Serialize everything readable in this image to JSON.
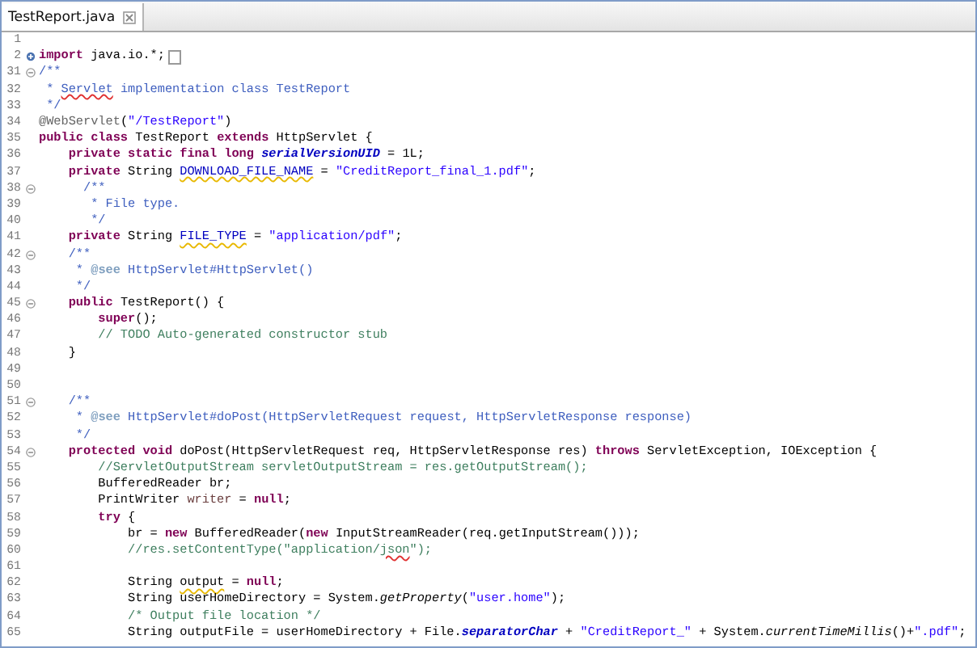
{
  "tabs": [
    {
      "label": "TestReport.java",
      "selected": true
    }
  ],
  "editor": {
    "lines": [
      {
        "number": "1"
      },
      {
        "number": "2",
        "collapsed": true,
        "folded_marker": true,
        "tokens": [
          {
            "kind": "kw",
            "text": "import"
          },
          {
            "kind": "plain",
            "text": " java.io.*;"
          }
        ]
      },
      {
        "number": "31",
        "collapsed": false,
        "tokens": [
          {
            "kind": "doc",
            "text": "/**"
          }
        ]
      },
      {
        "number": "32",
        "tokens": [
          {
            "kind": "doc",
            "text": " * "
          },
          {
            "kind": "doc-misspelled",
            "text": "Servlet"
          },
          {
            "kind": "doc",
            "text": " implementation class TestReport"
          }
        ]
      },
      {
        "number": "33",
        "tokens": [
          {
            "kind": "doc",
            "text": " */"
          }
        ]
      },
      {
        "number": "34",
        "tokens": [
          {
            "kind": "annot",
            "text": "@WebServlet"
          },
          {
            "kind": "plain",
            "text": "("
          },
          {
            "kind": "str",
            "text": "\"/TestReport\""
          },
          {
            "kind": "plain",
            "text": ")"
          }
        ]
      },
      {
        "number": "35",
        "tokens": [
          {
            "kind": "kw",
            "text": "public class"
          },
          {
            "kind": "plain",
            "text": " TestReport "
          },
          {
            "kind": "kw",
            "text": "extends"
          },
          {
            "kind": "plain",
            "text": " HttpServlet {"
          }
        ]
      },
      {
        "number": "36",
        "tokens": [
          {
            "kind": "kw",
            "text": "    private static final long "
          },
          {
            "kind": "static-field",
            "text": "serialVersionUID"
          },
          {
            "kind": "plain",
            "text": " = 1L;"
          }
        ]
      },
      {
        "number": "37",
        "tokens": [
          {
            "kind": "kw",
            "text": "    private"
          },
          {
            "kind": "plain",
            "text": " String "
          },
          {
            "kind": "field-warning",
            "text": "DOWNLOAD_FILE_NAME"
          },
          {
            "kind": "plain",
            "text": " = "
          },
          {
            "kind": "str",
            "text": "\"CreditReport_final_1.pdf\""
          },
          {
            "kind": "plain",
            "text": ";"
          }
        ]
      },
      {
        "number": "38",
        "collapsed": false,
        "tokens": [
          {
            "kind": "doc",
            "text": "      /**"
          }
        ]
      },
      {
        "number": "39",
        "tokens": [
          {
            "kind": "doc",
            "text": "       * File type."
          }
        ]
      },
      {
        "number": "40",
        "tokens": [
          {
            "kind": "doc",
            "text": "       */"
          }
        ]
      },
      {
        "number": "41",
        "tokens": [
          {
            "kind": "kw",
            "text": "    private"
          },
          {
            "kind": "plain",
            "text": " String "
          },
          {
            "kind": "field-warning",
            "text": "FILE_TYPE"
          },
          {
            "kind": "plain",
            "text": " = "
          },
          {
            "kind": "str",
            "text": "\"application/pdf\""
          },
          {
            "kind": "plain",
            "text": ";"
          }
        ]
      },
      {
        "number": "42",
        "collapsed": false,
        "tokens": [
          {
            "kind": "doc",
            "text": "    /**"
          }
        ]
      },
      {
        "number": "43",
        "tokens": [
          {
            "kind": "doc",
            "text": "     * "
          },
          {
            "kind": "doctag",
            "text": "@see"
          },
          {
            "kind": "doc",
            "text": " HttpServlet#HttpServlet()"
          }
        ]
      },
      {
        "number": "44",
        "tokens": [
          {
            "kind": "doc",
            "text": "     */"
          }
        ]
      },
      {
        "number": "45",
        "collapsed": false,
        "tokens": [
          {
            "kind": "kw",
            "text": "    public"
          },
          {
            "kind": "plain",
            "text": " TestReport() {"
          }
        ]
      },
      {
        "number": "46",
        "tokens": [
          {
            "kind": "kw",
            "text": "        super"
          },
          {
            "kind": "plain",
            "text": "();"
          }
        ]
      },
      {
        "number": "47",
        "tokens": [
          {
            "kind": "comment",
            "text": "        // TODO Auto-generated constructor stub"
          }
        ]
      },
      {
        "number": "48",
        "tokens": [
          {
            "kind": "plain",
            "text": "    }"
          }
        ]
      },
      {
        "number": "49"
      },
      {
        "number": "50"
      },
      {
        "number": "51",
        "collapsed": false,
        "tokens": [
          {
            "kind": "doc",
            "text": "    /**"
          }
        ]
      },
      {
        "number": "52",
        "tokens": [
          {
            "kind": "doc",
            "text": "     * "
          },
          {
            "kind": "doctag",
            "text": "@see"
          },
          {
            "kind": "doc",
            "text": " HttpServlet#doPost(HttpServletRequest request, HttpServletResponse response)"
          }
        ]
      },
      {
        "number": "53",
        "tokens": [
          {
            "kind": "doc",
            "text": "     */"
          }
        ]
      },
      {
        "number": "54",
        "collapsed": false,
        "tokens": [
          {
            "kind": "kw",
            "text": "    protected void"
          },
          {
            "kind": "plain",
            "text": " doPost(HttpServletRequest req, HttpServletResponse res) "
          },
          {
            "kind": "kw",
            "text": "throws"
          },
          {
            "kind": "plain",
            "text": " ServletException, IOException {"
          }
        ]
      },
      {
        "number": "55",
        "tokens": [
          {
            "kind": "comment",
            "text": "        //ServletOutputStream servletOutputStream = res.getOutputStream();"
          }
        ]
      },
      {
        "number": "56",
        "tokens": [
          {
            "kind": "plain",
            "text": "        BufferedReader br;"
          }
        ]
      },
      {
        "number": "57",
        "tokens": [
          {
            "kind": "plain",
            "text": "        PrintWriter "
          },
          {
            "kind": "local",
            "text": "writer"
          },
          {
            "kind": "plain",
            "text": " = "
          },
          {
            "kind": "kw",
            "text": "null"
          },
          {
            "kind": "plain",
            "text": ";"
          }
        ]
      },
      {
        "number": "58",
        "tokens": [
          {
            "kind": "kw",
            "text": "        try"
          },
          {
            "kind": "plain",
            "text": " {"
          }
        ]
      },
      {
        "number": "59",
        "tokens": [
          {
            "kind": "plain",
            "text": "            br = "
          },
          {
            "kind": "kw",
            "text": "new"
          },
          {
            "kind": "plain",
            "text": " BufferedReader("
          },
          {
            "kind": "kw",
            "text": "new"
          },
          {
            "kind": "plain",
            "text": " InputStreamReader(req.getInputStream()));"
          }
        ]
      },
      {
        "number": "60",
        "tokens": [
          {
            "kind": "comment",
            "text": "            //res.setContentType(\"application/"
          },
          {
            "kind": "comment-misspelled",
            "text": "json"
          },
          {
            "kind": "comment",
            "text": "\");"
          }
        ]
      },
      {
        "number": "61"
      },
      {
        "number": "62",
        "tokens": [
          {
            "kind": "plain",
            "text": "            String "
          },
          {
            "kind": "plain-warning",
            "text": "output"
          },
          {
            "kind": "plain",
            "text": " = "
          },
          {
            "kind": "kw",
            "text": "null"
          },
          {
            "kind": "plain",
            "text": ";"
          }
        ]
      },
      {
        "number": "63",
        "tokens": [
          {
            "kind": "plain",
            "text": "            String userHomeDirectory = System."
          },
          {
            "kind": "static-method",
            "text": "getProperty"
          },
          {
            "kind": "plain",
            "text": "("
          },
          {
            "kind": "str",
            "text": "\"user.home\""
          },
          {
            "kind": "plain",
            "text": ");"
          }
        ]
      },
      {
        "number": "64",
        "tokens": [
          {
            "kind": "comment",
            "text": "            /* Output file location */"
          }
        ]
      },
      {
        "number": "65",
        "tokens": [
          {
            "kind": "plain",
            "text": "            String outputFile = userHomeDirectory + File."
          },
          {
            "kind": "static-field",
            "text": "separatorChar"
          },
          {
            "kind": "plain",
            "text": " + "
          },
          {
            "kind": "str",
            "text": "\"CreditReport_\""
          },
          {
            "kind": "plain",
            "text": " + System."
          },
          {
            "kind": "static-method",
            "text": "currentTimeMillis"
          },
          {
            "kind": "plain",
            "text": "()+"
          },
          {
            "kind": "str",
            "text": "\".pdf\""
          },
          {
            "kind": "plain",
            "text": ";"
          }
        ]
      }
    ]
  }
}
